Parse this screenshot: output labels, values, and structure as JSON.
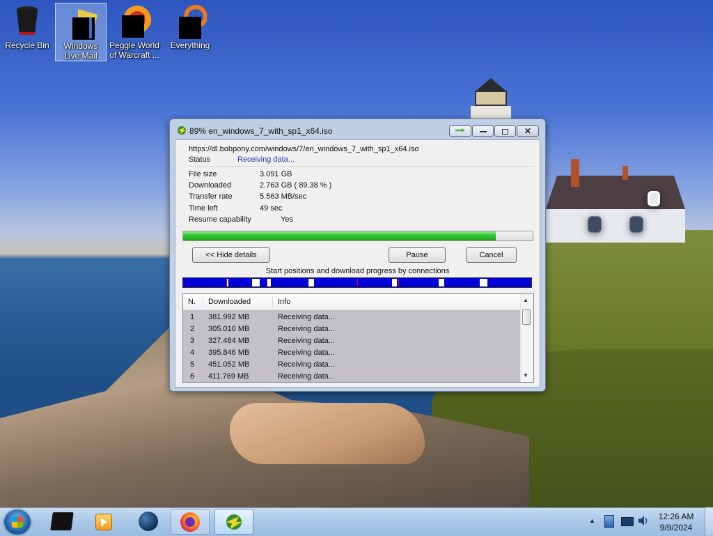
{
  "desktop": {
    "icons": [
      {
        "label": "Recycle Bin",
        "icon": "recycle-bin-icon"
      },
      {
        "label": "Windows Live Mail",
        "icon": "windows-live-mail-icon"
      },
      {
        "label": "Peggle World of Warcraft ...",
        "icon": "peggle-icon"
      },
      {
        "label": "Everything",
        "icon": "everything-search-icon"
      }
    ]
  },
  "window": {
    "title": "89% en_windows_7_with_sp1_x64.iso",
    "url": "https://dl.bobpony.com/windows/7/en_windows_7_with_sp1_x64.iso",
    "status_label": "Status",
    "status_value": "Receiving data...",
    "file_size_label": "File size",
    "file_size_value": "3.091  GB",
    "downloaded_label": "Downloaded",
    "downloaded_value": "2.763  GB  ( 89.38 % )",
    "transfer_rate_label": "Transfer rate",
    "transfer_rate_value": "5.563  MB/sec",
    "time_left_label": "Time left",
    "time_left_value": "49 sec",
    "resume_label": "Resume capability",
    "resume_value": "Yes",
    "progress_fraction": 0.8938,
    "hide_details_label": "<< Hide details",
    "pause_label": "Pause",
    "cancel_label": "Cancel",
    "connections_label": "Start positions and download progress by connections",
    "columns": {
      "n": "N.",
      "downloaded": "Downloaded",
      "info": "Info"
    },
    "connections": [
      {
        "n": "1",
        "downloaded": "381.992  MB",
        "info": "Receiving data..."
      },
      {
        "n": "2",
        "downloaded": "305.010  MB",
        "info": "Receiving data..."
      },
      {
        "n": "3",
        "downloaded": "327.484  MB",
        "info": "Receiving data..."
      },
      {
        "n": "4",
        "downloaded": "395.846  MB",
        "info": "Receiving data..."
      },
      {
        "n": "5",
        "downloaded": "451.052  MB",
        "info": "Receiving data..."
      },
      {
        "n": "6",
        "downloaded": "411.769  MB",
        "info": "Receiving data..."
      }
    ]
  },
  "taskbar": {
    "items": [
      "start-orb",
      "black-app-icon",
      "windows-media-player-icon",
      "globe-icon",
      "firefox-icon",
      "internet-download-manager-icon"
    ],
    "clock_time": "12:26 AM",
    "clock_date": "9/9/2024"
  },
  "colors": {
    "progress_green": "#2cc72c",
    "connection_blue": "#0000d8",
    "status_blue": "#1a3da8"
  }
}
